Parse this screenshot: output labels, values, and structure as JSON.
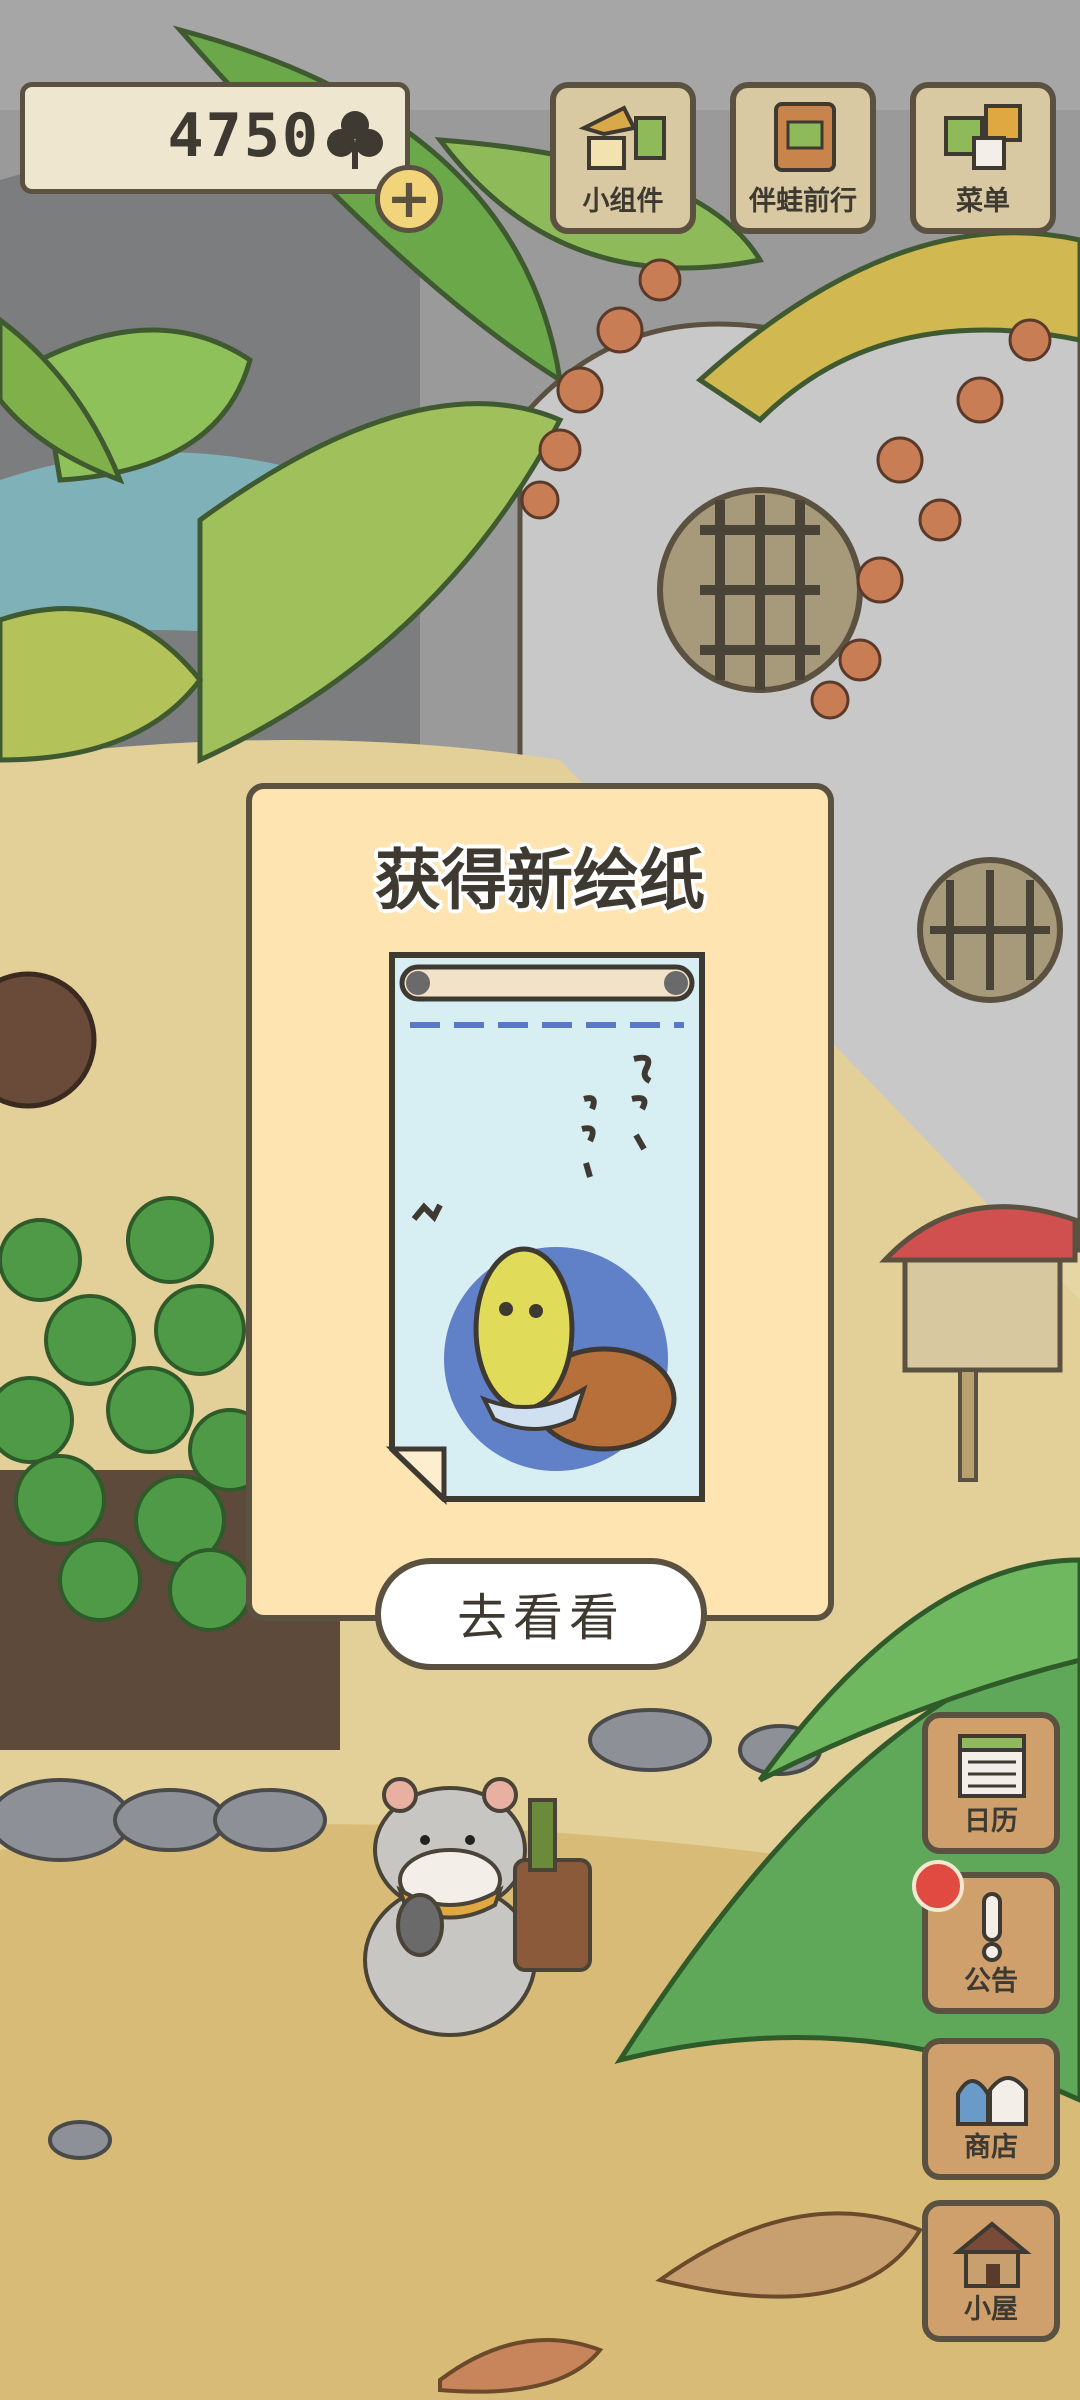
{
  "counter": {
    "value": "4750",
    "icon": "clover-icon"
  },
  "top_buttons": [
    {
      "label": "小组件",
      "icon": "widget-icon"
    },
    {
      "label": "伴蛙前行",
      "icon": "frog-travel-icon"
    },
    {
      "label": "菜单",
      "icon": "menu-icon"
    }
  ],
  "side_buttons": [
    {
      "label": "日历",
      "icon": "calendar-icon"
    },
    {
      "label": "公告",
      "icon": "exclamation-icon"
    },
    {
      "label": "商店",
      "icon": "shop-bag-icon"
    },
    {
      "label": "小屋",
      "icon": "house-icon"
    }
  ],
  "popup": {
    "title": "获得新绘纸",
    "button_label": "去看看"
  },
  "colors": {
    "panel": "#fde4b0",
    "outline": "#5a5140",
    "button_wood": "#cfa06c",
    "notice_red": "#e04a40"
  }
}
